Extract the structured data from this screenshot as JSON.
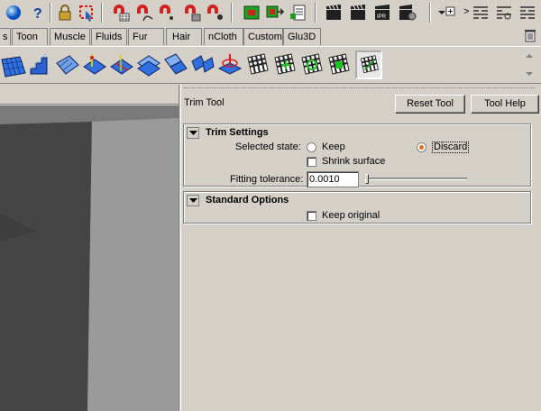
{
  "status_toolbar": {
    "icons": [
      "sphere-icon",
      "help-icon",
      "lock-icon",
      "select-region-icon",
      "snap-magnet-grid-icon",
      "snap-magnet-curve-icon",
      "snap-magnet-point-icon",
      "snap-magnet-view-icon",
      "snap-magnet-surface-icon",
      "history-icon",
      "render-frame-icon",
      "render-input-icon",
      "render-clapper-icon",
      "render-ipr-icon",
      "render-settings-icon",
      "options-menu-icon",
      "channel-box-icon",
      "attribute-editor-icon",
      "tool-settings-icon"
    ],
    "overflow_glyph": ">"
  },
  "shelf": {
    "tabs": [
      {
        "label": "s"
      },
      {
        "label": "Toon"
      },
      {
        "label": "Muscle"
      },
      {
        "label": "Fluids"
      },
      {
        "label": "Fur"
      },
      {
        "label": "Hair"
      },
      {
        "label": "nCloth"
      },
      {
        "label": "Custom"
      },
      {
        "label": "Glu3D"
      }
    ],
    "buttons": [
      "nurbs-plane-icon",
      "nurbs-stairs-icon",
      "nurbs-surface-icon",
      "nurbs-project-icon",
      "nurbs-rebuild-icon",
      "nurbs-split-icon",
      "nurbs-attach-icon",
      "nurbs-detach-icon",
      "nurbs-pivot-icon",
      "checker-uv-icon",
      "checker-move-icon",
      "checker-rotate-icon",
      "checker-scale-icon",
      "checker-trim-icon"
    ],
    "active_button_index": 13
  },
  "tool_settings": {
    "title": "Trim Tool",
    "reset_label": "Reset Tool",
    "help_label": "Tool Help",
    "trim_settings": {
      "title": "Trim Settings",
      "selected_state_label": "Selected state:",
      "keep_label": "Keep",
      "discard_label": "Discard",
      "selected": "Discard",
      "shrink_surface_label": "Shrink surface",
      "shrink_surface_checked": false,
      "fitting_tolerance_label": "Fitting tolerance:",
      "fitting_tolerance_value": "0.0010",
      "fitting_tolerance_slider": 0.01
    },
    "standard_options": {
      "title": "Standard Options",
      "keep_original_label": "Keep original",
      "keep_original_checked": false
    }
  },
  "colors": {
    "panel_bg": "#d4d0c8",
    "radio_selected": "#e07020",
    "viewport_surface": "#7a7a7a"
  }
}
